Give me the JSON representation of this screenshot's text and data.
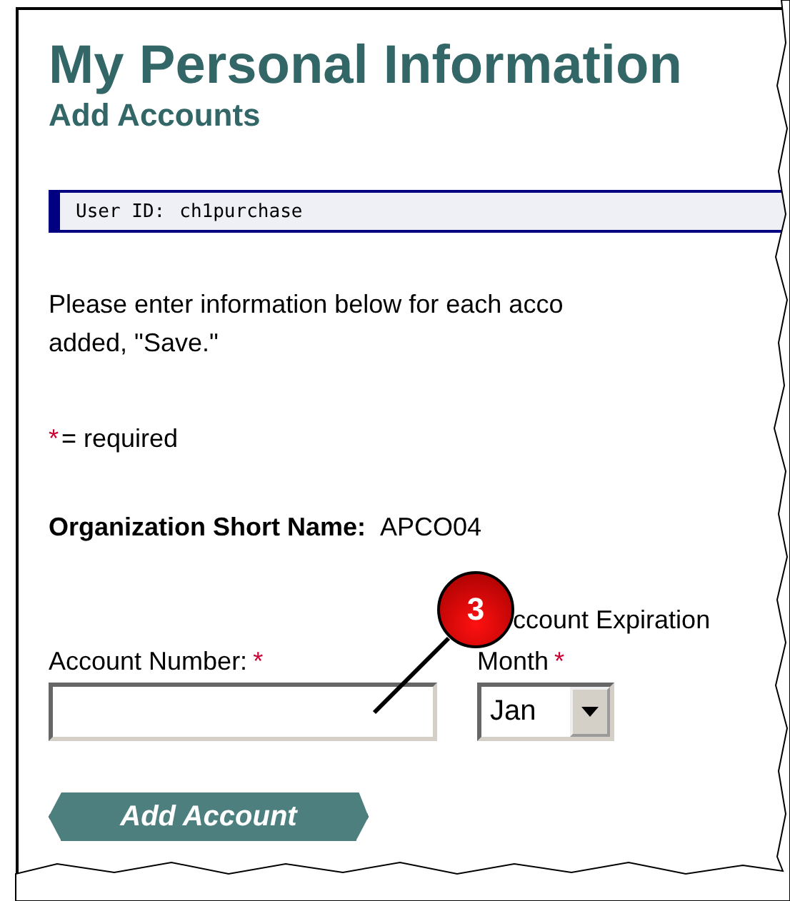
{
  "title": "My Personal Information",
  "subtitle": "Add Accounts",
  "user_bar": {
    "label": "User ID:",
    "value": "ch1purchase"
  },
  "instructions": [
    "Please enter information below for each acco",
    "added, \"Save.\""
  ],
  "required_note": {
    "mark": "*",
    "text": "= required"
  },
  "organization": {
    "label": "Organization Short Name:",
    "value": "APCO04"
  },
  "expiration_heading": "ccount Expiration",
  "fields": [
    {
      "kind": "text",
      "label": "Account Number:",
      "required_mark": "*"
    },
    {
      "kind": "select",
      "label": "Month",
      "required_mark": "*",
      "value": "Jan"
    }
  ],
  "add_button": "Add Account",
  "callout": {
    "number": "3"
  }
}
